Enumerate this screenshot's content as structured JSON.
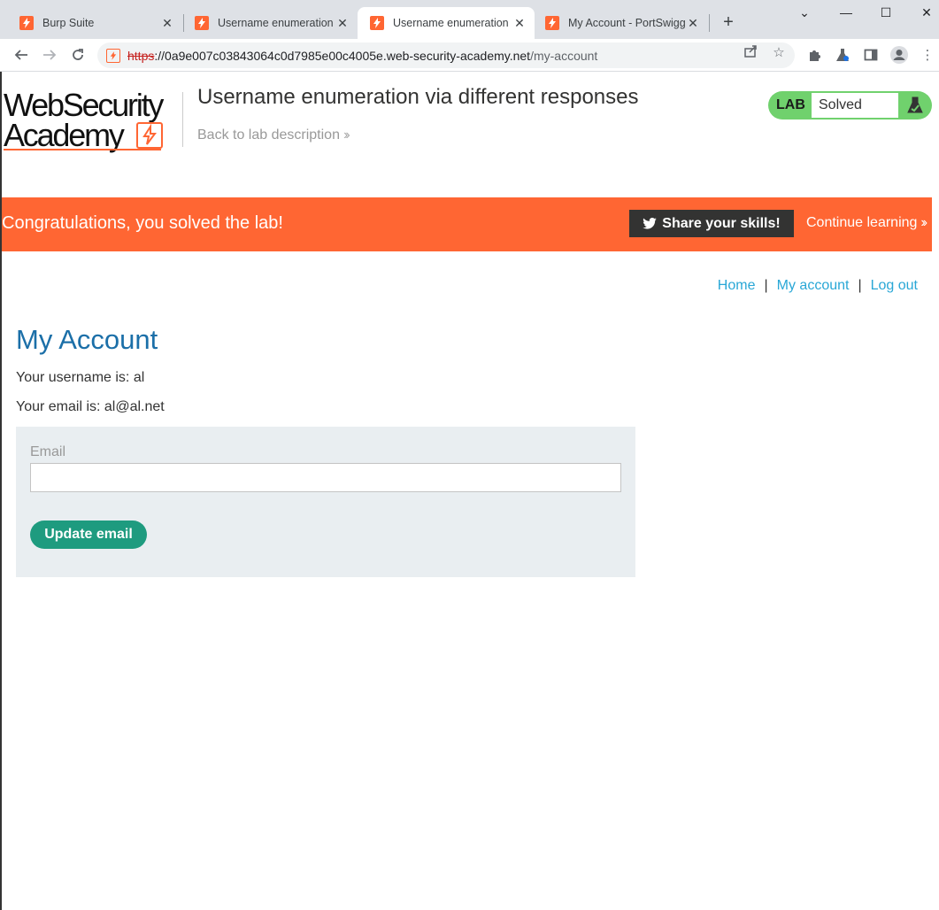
{
  "browser": {
    "tabs": [
      {
        "title": "Burp Suite",
        "active": false
      },
      {
        "title": "Username enumeration v",
        "active": false
      },
      {
        "title": "Username enumeration v",
        "active": true
      },
      {
        "title": "My Account - PortSwigge",
        "active": false
      }
    ],
    "new_tab_label": "+",
    "controls": {
      "dropdown": "⌄",
      "minimize": "—",
      "maximize": "☐",
      "close": "✕"
    },
    "url": {
      "scheme": "https",
      "host": "://0a9e007c03843064c0d7985e00c4005e.web-security-academy.net",
      "path": "/my-account"
    }
  },
  "lab": {
    "logo_line1": "WebSecurity",
    "logo_line2": "Academy",
    "title": "Username enumeration via different responses",
    "back_link": "Back to lab description",
    "status_label": "LAB",
    "status_value": "Solved"
  },
  "banner": {
    "message": "Congratulations, you solved the lab!",
    "share_label": "Share your skills!",
    "continue_label": "Continue learning"
  },
  "nav": {
    "home": "Home",
    "my_account": "My account",
    "log_out": "Log out",
    "separator": "|"
  },
  "account": {
    "heading": "My Account",
    "username_line": "Your username is: al",
    "email_line": "Your email is: al@al.net",
    "email_label": "Email",
    "email_value": "",
    "update_button": "Update email"
  },
  "colors": {
    "brand_orange": "#ff6633",
    "lab_green": "#70d16d",
    "link_blue": "#29a7d6",
    "heading_blue": "#1b6fa8",
    "button_teal": "#1e9b7f"
  }
}
